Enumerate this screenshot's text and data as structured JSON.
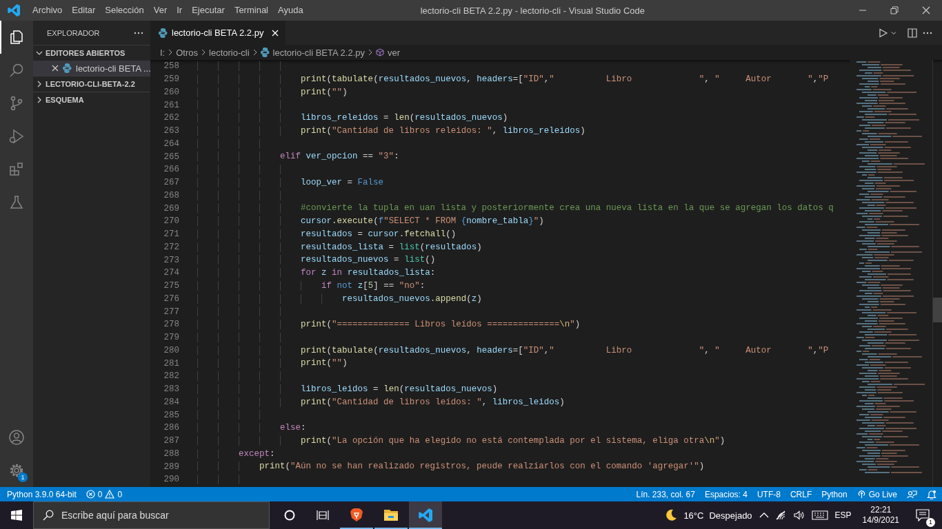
{
  "title_bar": {
    "menu": [
      "Archivo",
      "Editar",
      "Selección",
      "Ver",
      "Ir",
      "Ejecutar",
      "Terminal",
      "Ayuda"
    ],
    "title": "lectorio-cli BETA 2.2.py - lectorio-cli - Visual Studio Code"
  },
  "activity_bar": {
    "items": [
      {
        "kind": "explorer",
        "selected": true
      },
      {
        "kind": "search",
        "selected": false
      },
      {
        "kind": "source-control",
        "selected": false
      },
      {
        "kind": "run",
        "selected": false
      },
      {
        "kind": "extensions",
        "selected": false
      },
      {
        "kind": "testing",
        "selected": false
      }
    ],
    "settings_badge": "1"
  },
  "sidebar": {
    "title": "EXPLORADOR",
    "sections": [
      {
        "label": "EDITORES ABIERTOS",
        "expanded": true,
        "items": [
          {
            "label": "lectorio-cli BETA ..."
          }
        ]
      },
      {
        "label": "LECTORIO-CLI-BETA-2.2",
        "expanded": false
      },
      {
        "label": "ESQUEMA",
        "expanded": false
      }
    ]
  },
  "tabs": [
    {
      "label": "lectorio-cli BETA 2.2.py",
      "selected": true
    }
  ],
  "breadcrumbs": [
    {
      "label": "I:",
      "kind": "folder"
    },
    {
      "label": "Otros",
      "kind": "folder"
    },
    {
      "label": "lectorio-cli",
      "kind": "folder"
    },
    {
      "label": "lectorio-cli BETA 2.2.py",
      "kind": "file"
    },
    {
      "label": "ver",
      "kind": "symbol"
    }
  ],
  "editor": {
    "lines": [
      {
        "number": "258"
      },
      {
        "number": "259",
        "tokens": [
          {
            "kind": "fn",
            "text": "                    print"
          },
          {
            "kind": "op",
            "text": "("
          },
          {
            "kind": "fn",
            "text": "tabulate"
          },
          {
            "kind": "op",
            "text": "("
          },
          {
            "kind": "var",
            "text": "resultados_nuevos"
          },
          {
            "kind": "op",
            "text": ", "
          },
          {
            "kind": "var",
            "text": "headers"
          },
          {
            "kind": "op",
            "text": "=["
          },
          {
            "kind": "str",
            "text": "\"ID\""
          },
          {
            "kind": "op",
            "text": ","
          },
          {
            "kind": "str",
            "text": "\"          Libro             \""
          },
          {
            "kind": "op",
            "text": ", "
          },
          {
            "kind": "str",
            "text": "\"     Autor       \""
          },
          {
            "kind": "op",
            "text": ","
          },
          {
            "kind": "str",
            "text": "\"P"
          }
        ]
      },
      {
        "number": "260",
        "tokens": [
          {
            "kind": "fn",
            "text": "                    print"
          },
          {
            "kind": "op",
            "text": "("
          },
          {
            "kind": "str",
            "text": "\"\""
          },
          {
            "kind": "op",
            "text": ")"
          }
        ]
      },
      {
        "number": "261"
      },
      {
        "number": "262",
        "tokens": [
          {
            "kind": "var",
            "text": "                    libros_releidos"
          },
          {
            "kind": "op",
            "text": " = "
          },
          {
            "kind": "fn",
            "text": "len"
          },
          {
            "kind": "op",
            "text": "("
          },
          {
            "kind": "var",
            "text": "resultados_nuevos"
          },
          {
            "kind": "op",
            "text": ")"
          }
        ]
      },
      {
        "number": "263",
        "tokens": [
          {
            "kind": "fn",
            "text": "                    print"
          },
          {
            "kind": "op",
            "text": "("
          },
          {
            "kind": "str",
            "text": "\"Cantidad de libros releidos: \""
          },
          {
            "kind": "op",
            "text": ", "
          },
          {
            "kind": "var",
            "text": "libros_releidos"
          },
          {
            "kind": "op",
            "text": ")"
          }
        ]
      },
      {
        "number": "264"
      },
      {
        "number": "265",
        "tokens": [
          {
            "kind": "kw",
            "text": "                elif "
          },
          {
            "kind": "var",
            "text": "ver_opcion"
          },
          {
            "kind": "op",
            "text": " == "
          },
          {
            "kind": "str",
            "text": "\"3\""
          },
          {
            "kind": "op",
            "text": ":"
          }
        ]
      },
      {
        "number": "266"
      },
      {
        "number": "267",
        "tokens": [
          {
            "kind": "var",
            "text": "                    loop_ver"
          },
          {
            "kind": "op",
            "text": " = "
          },
          {
            "kind": "const",
            "text": "False"
          }
        ]
      },
      {
        "number": "268"
      },
      {
        "number": "269",
        "tokens": [
          {
            "kind": "cmt",
            "text": "                    #convierte la tupla en uan lista y posteriormente crea una nueva lista en la que se agregan los datos q"
          }
        ]
      },
      {
        "number": "270",
        "tokens": [
          {
            "kind": "var",
            "text": "                    cursor"
          },
          {
            "kind": "op",
            "text": "."
          },
          {
            "kind": "fn",
            "text": "execute"
          },
          {
            "kind": "op",
            "text": "("
          },
          {
            "kind": "const",
            "text": "f"
          },
          {
            "kind": "str",
            "text": "\"SELECT * FROM "
          },
          {
            "kind": "const",
            "text": "{"
          },
          {
            "kind": "var",
            "text": "nombre_tabla"
          },
          {
            "kind": "const",
            "text": "}"
          },
          {
            "kind": "str",
            "text": "\""
          },
          {
            "kind": "op",
            "text": ")"
          }
        ]
      },
      {
        "number": "271",
        "tokens": [
          {
            "kind": "var",
            "text": "                    resultados"
          },
          {
            "kind": "op",
            "text": " = "
          },
          {
            "kind": "var",
            "text": "cursor"
          },
          {
            "kind": "op",
            "text": "."
          },
          {
            "kind": "fn",
            "text": "fetchall"
          },
          {
            "kind": "op",
            "text": "()"
          }
        ]
      },
      {
        "number": "272",
        "tokens": [
          {
            "kind": "var",
            "text": "                    resultados_lista"
          },
          {
            "kind": "op",
            "text": " = "
          },
          {
            "kind": "cls",
            "text": "list"
          },
          {
            "kind": "op",
            "text": "("
          },
          {
            "kind": "var",
            "text": "resultados"
          },
          {
            "kind": "op",
            "text": ")"
          }
        ]
      },
      {
        "number": "273",
        "tokens": [
          {
            "kind": "var",
            "text": "                    resultados_nuevos"
          },
          {
            "kind": "op",
            "text": " = "
          },
          {
            "kind": "cls",
            "text": "list"
          },
          {
            "kind": "op",
            "text": "()"
          }
        ]
      },
      {
        "number": "274",
        "tokens": [
          {
            "kind": "kw",
            "text": "                    for "
          },
          {
            "kind": "var",
            "text": "z "
          },
          {
            "kind": "kw",
            "text": "in "
          },
          {
            "kind": "var",
            "text": "resultados_lista"
          },
          {
            "kind": "op",
            "text": ":"
          }
        ]
      },
      {
        "number": "275",
        "tokens": [
          {
            "kind": "kw",
            "text": "                        if "
          },
          {
            "kind": "const",
            "text": "not "
          },
          {
            "kind": "var",
            "text": "z"
          },
          {
            "kind": "op",
            "text": "["
          },
          {
            "kind": "num",
            "text": "5"
          },
          {
            "kind": "op",
            "text": "] == "
          },
          {
            "kind": "str",
            "text": "\"no\""
          },
          {
            "kind": "op",
            "text": ":"
          }
        ]
      },
      {
        "number": "276",
        "tokens": [
          {
            "kind": "var",
            "text": "                            resultados_nuevos"
          },
          {
            "kind": "op",
            "text": "."
          },
          {
            "kind": "fn",
            "text": "append"
          },
          {
            "kind": "op",
            "text": "("
          },
          {
            "kind": "var",
            "text": "z"
          },
          {
            "kind": "op",
            "text": ")"
          }
        ]
      },
      {
        "number": "277"
      },
      {
        "number": "278",
        "tokens": [
          {
            "kind": "fn",
            "text": "                    print"
          },
          {
            "kind": "op",
            "text": "("
          },
          {
            "kind": "str",
            "text": "\"============== Libros leídos =============="
          },
          {
            "kind": "esc",
            "text": "\\n"
          },
          {
            "kind": "str",
            "text": "\""
          },
          {
            "kind": "op",
            "text": ")"
          }
        ]
      },
      {
        "number": "279"
      },
      {
        "number": "280",
        "tokens": [
          {
            "kind": "fn",
            "text": "                    print"
          },
          {
            "kind": "op",
            "text": "("
          },
          {
            "kind": "fn",
            "text": "tabulate"
          },
          {
            "kind": "op",
            "text": "("
          },
          {
            "kind": "var",
            "text": "resultados_nuevos"
          },
          {
            "kind": "op",
            "text": ", "
          },
          {
            "kind": "var",
            "text": "headers"
          },
          {
            "kind": "op",
            "text": "=["
          },
          {
            "kind": "str",
            "text": "\"ID\""
          },
          {
            "kind": "op",
            "text": ","
          },
          {
            "kind": "str",
            "text": "\"          Libro             \""
          },
          {
            "kind": "op",
            "text": ", "
          },
          {
            "kind": "str",
            "text": "\"     Autor       \""
          },
          {
            "kind": "op",
            "text": ","
          },
          {
            "kind": "str",
            "text": "\"P"
          }
        ]
      },
      {
        "number": "281",
        "tokens": [
          {
            "kind": "fn",
            "text": "                    print"
          },
          {
            "kind": "op",
            "text": "("
          },
          {
            "kind": "str",
            "text": "\"\""
          },
          {
            "kind": "op",
            "text": ")"
          }
        ]
      },
      {
        "number": "282"
      },
      {
        "number": "283",
        "tokens": [
          {
            "kind": "var",
            "text": "                    libros_leidos"
          },
          {
            "kind": "op",
            "text": " = "
          },
          {
            "kind": "fn",
            "text": "len"
          },
          {
            "kind": "op",
            "text": "("
          },
          {
            "kind": "var",
            "text": "resultados_nuevos"
          },
          {
            "kind": "op",
            "text": ")"
          }
        ]
      },
      {
        "number": "284",
        "tokens": [
          {
            "kind": "fn",
            "text": "                    print"
          },
          {
            "kind": "op",
            "text": "("
          },
          {
            "kind": "str",
            "text": "\"Cantidad de libros leídos: \""
          },
          {
            "kind": "op",
            "text": ", "
          },
          {
            "kind": "var",
            "text": "libros_leidos"
          },
          {
            "kind": "op",
            "text": ")"
          }
        ]
      },
      {
        "number": "285"
      },
      {
        "number": "286",
        "tokens": [
          {
            "kind": "kw",
            "text": "                else"
          },
          {
            "kind": "op",
            "text": ":"
          }
        ]
      },
      {
        "number": "287",
        "tokens": [
          {
            "kind": "fn",
            "text": "                    print"
          },
          {
            "kind": "op",
            "text": "("
          },
          {
            "kind": "str",
            "text": "\"La opción que ha elegido no está contemplada por el sistema, eliga otra"
          },
          {
            "kind": "esc",
            "text": "\\n"
          },
          {
            "kind": "str",
            "text": "\""
          },
          {
            "kind": "op",
            "text": ")"
          }
        ]
      },
      {
        "number": "288",
        "tokens": [
          {
            "kind": "kw",
            "text": "        except"
          },
          {
            "kind": "op",
            "text": ":"
          }
        ]
      },
      {
        "number": "289",
        "tokens": [
          {
            "kind": "fn",
            "text": "            print"
          },
          {
            "kind": "op",
            "text": "("
          },
          {
            "kind": "str",
            "text": "\"Aún no se han realizado registros, peude realziarlos con el comando 'agregar'\""
          },
          {
            "kind": "op",
            "text": ")"
          }
        ]
      },
      {
        "number": "290"
      }
    ]
  },
  "status_bar": {
    "interpreter": "Python 3.9.0 64-bit",
    "errors": "0",
    "warnings": "0",
    "right": [
      {
        "kind": "text",
        "label": "Lín. 233, col. 67"
      },
      {
        "kind": "text",
        "label": "Espacios: 4"
      },
      {
        "kind": "text",
        "label": "UTF-8"
      },
      {
        "kind": "text",
        "label": "CRLF"
      },
      {
        "kind": "text",
        "label": "Python"
      },
      {
        "kind": "broadcast",
        "label": "Go Live"
      },
      {
        "kind": "feedback"
      },
      {
        "kind": "bell"
      }
    ]
  },
  "taskbar": {
    "search_placeholder": "Escribe aquí para buscar",
    "apps": [
      {
        "kind": "browser",
        "selected": false
      },
      {
        "kind": "files",
        "selected": false
      },
      {
        "kind": "vscode",
        "selected": true
      }
    ],
    "weather": {
      "temperature": "16°C",
      "condition": "Despejado"
    },
    "language": "ESP",
    "time": "22:21",
    "date": "14/9/2021",
    "notifications": "1"
  }
}
